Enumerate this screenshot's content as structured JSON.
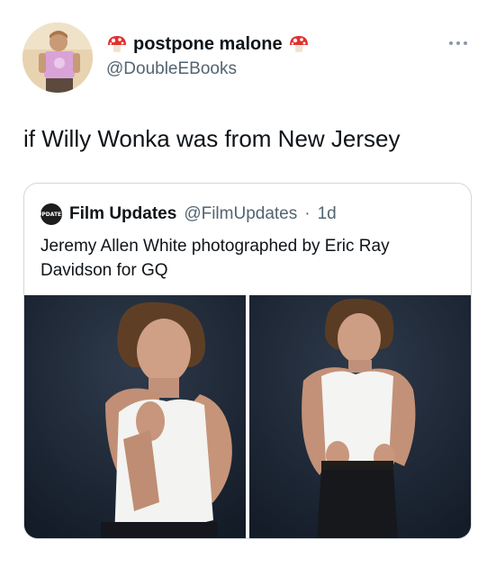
{
  "tweet": {
    "author": {
      "display_name": "postpone malone",
      "handle": "@DoubleEBooks",
      "avatar_icon": "profile-photo",
      "name_emoji": "mushroom-icon"
    },
    "text": "if Willy Wonka was from New Jersey",
    "more_icon": "more-horizontal-icon"
  },
  "quote": {
    "author_name": "Film Updates",
    "handle": "@FilmUpdates",
    "separator": "·",
    "time": "1d",
    "avatar_text": "UPDATES",
    "text": "Jeremy Allen White photographed by Eric Ray Davidson for GQ",
    "media": [
      {
        "name": "photo-1"
      },
      {
        "name": "photo-2"
      }
    ]
  },
  "colors": {
    "text": "#0f1419",
    "secondary": "#536471",
    "border": "#cfd9de",
    "photo_bg": "#1f2a38"
  }
}
